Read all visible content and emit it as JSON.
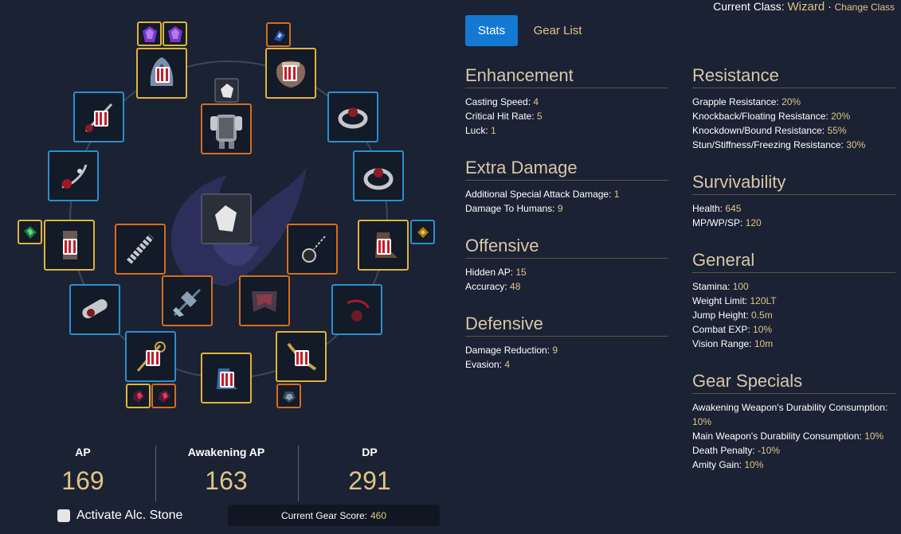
{
  "header": {
    "class_prefix": "Current Class:",
    "class_name": "Wizard",
    "separator": "·",
    "change_class": "Change Class"
  },
  "tabs": [
    {
      "label": "Stats",
      "active": true
    },
    {
      "label": "Gear List",
      "active": false
    }
  ],
  "sections": {
    "enhancement": {
      "title": "Enhancement",
      "rows": [
        {
          "label": "Casting Speed: ",
          "value": "4"
        },
        {
          "label": "Critical Hit Rate: ",
          "value": "5"
        },
        {
          "label": "Luck: ",
          "value": "1"
        }
      ]
    },
    "extra_damage": {
      "title": "Extra Damage",
      "rows": [
        {
          "label": "Additional Special Attack Damage: ",
          "value": "1"
        },
        {
          "label": "Damage To Humans: ",
          "value": "9"
        }
      ]
    },
    "offensive": {
      "title": "Offensive",
      "rows": [
        {
          "label": "Hidden AP: ",
          "value": "15"
        },
        {
          "label": "Accuracy: ",
          "value": "48"
        }
      ]
    },
    "defensive": {
      "title": "Defensive",
      "rows": [
        {
          "label": "Damage Reduction: ",
          "value": "9"
        },
        {
          "label": "Evasion: ",
          "value": "4"
        }
      ]
    },
    "resistance": {
      "title": "Resistance",
      "rows": [
        {
          "label": "Grapple Resistance: ",
          "value": "20%"
        },
        {
          "label": "Knockback/Floating Resistance: ",
          "value": "20%"
        },
        {
          "label": "Knockdown/Bound Resistance: ",
          "value": "55%"
        },
        {
          "label": "Stun/Stiffness/Freezing Resistance: ",
          "value": "30%"
        }
      ]
    },
    "survivability": {
      "title": "Survivability",
      "rows": [
        {
          "label": "Health: ",
          "value": "645"
        },
        {
          "label": "MP/WP/SP: ",
          "value": "120"
        }
      ]
    },
    "general": {
      "title": "General",
      "rows": [
        {
          "label": "Stamina: ",
          "value": "100"
        },
        {
          "label": "Weight Limit: ",
          "value": "120LT"
        },
        {
          "label": "Jump Height: ",
          "value": "0.5m"
        },
        {
          "label": "Combat EXP: ",
          "value": "10%"
        },
        {
          "label": "Vision Range: ",
          "value": "10m"
        }
      ]
    },
    "gear_specials": {
      "title": "Gear Specials",
      "rows": [
        {
          "label": "Awakening Weapon's Durability Consumption: ",
          "value": "10%"
        },
        {
          "label": "Main Weapon's Durability Consumption: ",
          "value": "10%"
        },
        {
          "label": "Death Penalty: ",
          "value": "-10%"
        },
        {
          "label": "Amity Gain: ",
          "value": "10%"
        }
      ]
    }
  },
  "totals": {
    "ap_label": "AP",
    "ap_value": "169",
    "awk_label": "Awakening AP",
    "awk_value": "163",
    "dp_label": "DP",
    "dp_value": "291"
  },
  "alchemy": {
    "label": "Activate Alc. Stone",
    "checked": false
  },
  "gear_score": {
    "label": "Current Gear Score:",
    "value": "460"
  },
  "colors": {
    "accent_blue": "#1479d3",
    "gold": "#e0c486",
    "slot_blue": "#2a8fcf",
    "slot_yellow": "#e0b33a",
    "slot_orange": "#d26e1f",
    "background": "#1b2234"
  }
}
